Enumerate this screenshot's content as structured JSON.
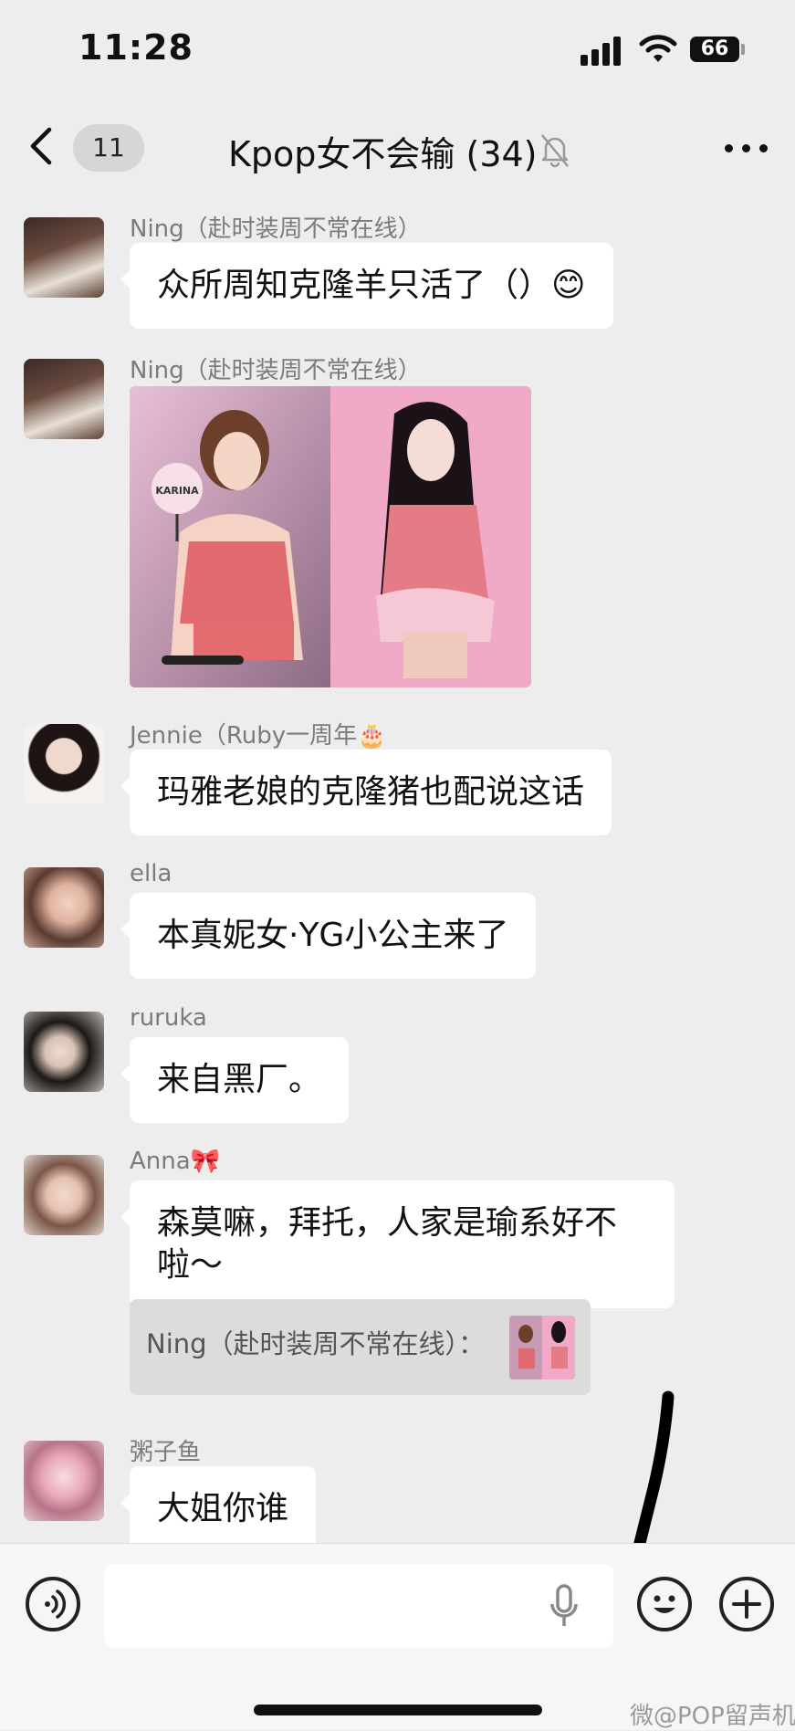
{
  "status": {
    "time": "11:28",
    "battery": "66"
  },
  "nav": {
    "unread": "11",
    "title": "Kpop女不会输 (34)"
  },
  "messages": [
    {
      "sender": "Ning（赴时装周不常在线）",
      "text": "众所周知克隆羊只活了（）😊"
    },
    {
      "sender": "Ning（赴时装周不常在线）",
      "image_caption": "KARINA"
    },
    {
      "sender": "Jennie（Ruby一周年🎂",
      "text": "玛雅老娘的克隆猪也配说这话"
    },
    {
      "sender": "ella",
      "text": "本真妮女·YG小公主来了"
    },
    {
      "sender": "ruruka",
      "text": "来自黑厂。"
    },
    {
      "sender": "Anna🎀",
      "text_line1": "森莫嘛，拜托，人家是瑜系好不",
      "text_line2": "啦～"
    },
    {
      "sender": "粥子鱼",
      "text": "大姐你谁"
    }
  ],
  "quote": {
    "text": "Ning（赴时装周不常在线）："
  },
  "input": {
    "value": "",
    "placeholder": ""
  },
  "watermark": "微@POP留声机",
  "colors": {
    "background": "#ededed",
    "bubble": "#ffffff",
    "sender": "#7b7b7b",
    "quote_bg": "#dcdcdc"
  },
  "icons": [
    "back-icon",
    "mute-bell-icon",
    "more-icon",
    "voice-icon",
    "mic-icon",
    "emoji-icon",
    "plus-icon"
  ]
}
